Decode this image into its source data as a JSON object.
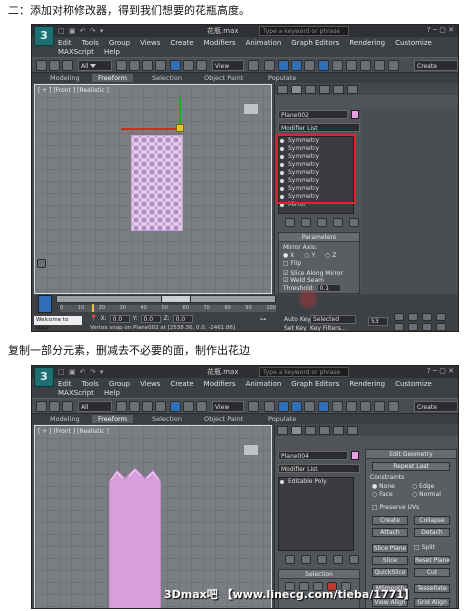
{
  "captions": {
    "top": "二：添加对称修改器，得到我们想要的花瓶高度。",
    "middle": "复制一部分元素，删减去不必要的面，制作出花边"
  },
  "app": {
    "logo": "3",
    "title": "花瓶.max",
    "search_placeholder": "Type a keyword or phrase",
    "menus": [
      "Edit",
      "Tools",
      "Group",
      "Views",
      "Create",
      "Modifiers",
      "Animation",
      "Graph Editors",
      "Rendering",
      "Customize"
    ],
    "menus_row2": [
      "MAXScript",
      "Help"
    ],
    "menus_row2_b": [
      "MAXScript",
      "Help"
    ],
    "selection_set": "Create Selection S",
    "filter_all": "All",
    "ref_coord": "View",
    "tabs": [
      "Modeling",
      "Freeform",
      "Selection",
      "Object Paint",
      "Populate"
    ]
  },
  "shot1": {
    "viewport_label": "[ + ] [Front ] [Realistic ]",
    "object_name": "Plane002",
    "modifier_list": "Modifier List",
    "stack": [
      "Symmetry",
      "Symmetry",
      "Symmetry",
      "Symmetry",
      "Symmetry",
      "Symmetry",
      "Symmetry",
      "Symmetry",
      "Mirror"
    ],
    "params_title": "Parameters",
    "mirror_axis": "Mirror Axis:",
    "axes": [
      "X",
      "Y",
      "Z"
    ],
    "flip": "Flip",
    "slice": "Slice Along Mirror",
    "weld": "Weld Seam",
    "threshold_label": "Threshold:",
    "threshold_value": "0.1",
    "timeline": "53 / 100",
    "ticks": [
      "0",
      "10",
      "20",
      "30",
      "40",
      "50",
      "60",
      "70",
      "80",
      "90",
      "100"
    ],
    "welcome": "Welcome to MAX!",
    "status": "Vertex snap on Plane002 at [2538.36, 0.0, -2461.86]",
    "autokey": "Auto Key",
    "selected": "Selected",
    "setkey": "Set Key",
    "keyfilters": "Key Filters...",
    "frame": "53",
    "coords": {
      "x": "0.0",
      "y": "0.0",
      "z": "0.0"
    }
  },
  "shot2": {
    "viewport_label": "[ + ] [Front ] [Realistic ]",
    "object_name": "Plane004",
    "modifier_list": "Modifier List",
    "stack": [
      "Editable Poly"
    ],
    "edit_geom_title": "Edit Geometry",
    "repeat_last": "Repeat Last",
    "constraints": "Constraints",
    "c_none": "None",
    "c_edge": "Edge",
    "c_face": "Face",
    "c_normal": "Normal",
    "preserve_uvs": "Preserve UVs",
    "create": "Create",
    "collapse": "Collapse",
    "attach": "Attach",
    "detach": "Detach",
    "slice_plane": "Slice Plane",
    "split": "Split",
    "slice": "Slice",
    "reset_plane": "Reset Plane",
    "quickslice": "QuickSlice",
    "cut": "Cut",
    "selection_title": "Selection",
    "msmooth": "MSmooth",
    "tessellate": "Tessellate",
    "view_align": "View Align",
    "grid_align": "Grid Align"
  },
  "watermark": "3Dmax吧 【www.linecg.com/tieba/1771】"
}
